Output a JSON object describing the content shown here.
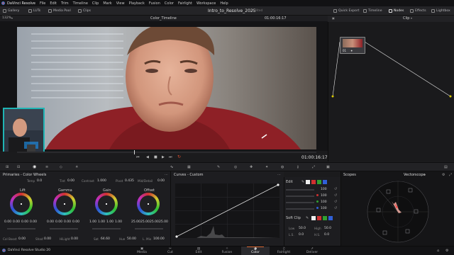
{
  "menu": {
    "brand": "DaVinci Resolve",
    "items": [
      "File",
      "Edit",
      "Trim",
      "Timeline",
      "Clip",
      "Mark",
      "View",
      "Playback",
      "Fusion",
      "Color",
      "Fairlight",
      "Workspace",
      "Help"
    ]
  },
  "toolbar": {
    "gallery": "Gallery",
    "luts": "LUTs",
    "media_pool": "Media Pool",
    "clips": "Clips",
    "project_title": "Intro_to_Resolve_2025",
    "edited": "Edited",
    "quick_export": "Quick Export",
    "timeline": "Timeline",
    "nodes": "Nodes",
    "effects": "Effects",
    "lightbox": "Lightbox"
  },
  "viewer": {
    "zoom": "132%",
    "timeline_name": "Color_Timeline",
    "timecode_top": "01:00:16:17",
    "timecode_bottom": "01:00:16:17",
    "progress": 0.39
  },
  "node_editor": {
    "mode": "Clip",
    "node_label": "01"
  },
  "primaries": {
    "title": "Primaries - Color Wheels",
    "temp_label": "Temp",
    "temp_value": "0.0",
    "tint_label": "Tint",
    "tint_value": "0.00",
    "contrast_label": "Contrast",
    "contrast_value": "1.000",
    "pivot_label": "Pivot",
    "pivot_value": "0.435",
    "middetail_label": "Mid/Detail",
    "middetail_value": "0.00",
    "wheels": [
      {
        "name": "Lift",
        "values": [
          "0.00",
          "0.00",
          "0.00",
          "0.00"
        ]
      },
      {
        "name": "Gamma",
        "values": [
          "0.00",
          "0.00",
          "0.00",
          "0.00"
        ]
      },
      {
        "name": "Gain",
        "values": [
          "1.00",
          "1.00",
          "1.00",
          "1.00"
        ]
      },
      {
        "name": "Offset",
        "values": [
          "25.00",
          "25.00",
          "25.00",
          "25.00"
        ]
      }
    ],
    "footer": {
      "colboost_label": "Col Boost",
      "colboost_value": "0.00",
      "shad_label": "Shad",
      "shad_value": "0.00",
      "hilight_label": "HiLight",
      "hilight_value": "0.00",
      "sat_label": "Sat",
      "sat_value": "64.60",
      "hue_label": "Hue",
      "hue_value": "50.00",
      "lmix_label": "L. Mix",
      "lmix_value": "100.00"
    }
  },
  "curves": {
    "title": "Curves - Custom"
  },
  "edit_panel": {
    "title": "Edit",
    "value_all": "100",
    "values": [
      "100",
      "100",
      "100",
      "100"
    ],
    "softclip_title": "Soft Clip",
    "low_label": "Low",
    "low_value": "50.0",
    "high_label": "High",
    "high_value": "50.0",
    "ls_label": "L.S.",
    "ls_value": "0.0",
    "hs_label": "H.S.",
    "hs_value": "0.0"
  },
  "scopes": {
    "title": "Scopes",
    "type": "Vectorscope"
  },
  "pages": {
    "app": "DaVinci Resolve Studio 20",
    "items": [
      "Media",
      "Cut",
      "Edit",
      "Fusion",
      "Color",
      "Fairlight",
      "Deliver"
    ],
    "active": "Color"
  },
  "colors": {
    "accent": "#e0703a",
    "pip_border": "#1fb4b4",
    "node_link": "#e8e8e8",
    "node_dot": "#d8c800"
  }
}
